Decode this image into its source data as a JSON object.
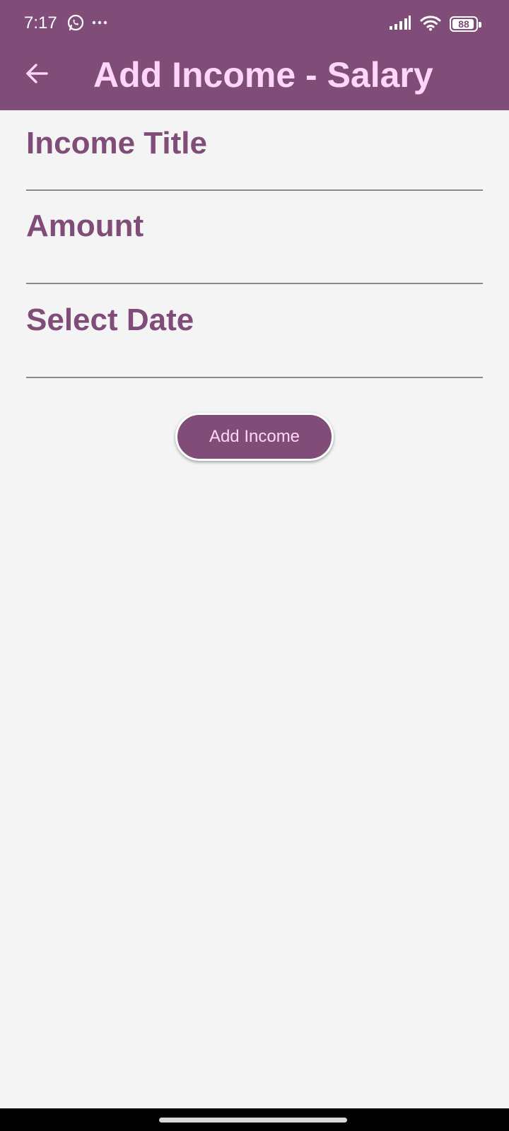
{
  "status_bar": {
    "time": "7:17",
    "battery": "88",
    "icons": [
      "whatsapp-icon",
      "more-dots-icon",
      "signal-icon",
      "wifi-icon",
      "battery-icon"
    ]
  },
  "app_bar": {
    "title": "Add Income - Salary",
    "back_icon": "arrow-left-icon"
  },
  "form": {
    "income_title_placeholder": "Income Title",
    "income_title_value": "",
    "amount_placeholder": "Amount",
    "amount_value": "",
    "date_placeholder": "Select Date",
    "date_value": ""
  },
  "submit_label": "Add Income",
  "colors": {
    "primary": "#804d78",
    "on_primary": "#ffd6f8",
    "background": "#f4f4f4",
    "divider": "#8a8a8a"
  }
}
